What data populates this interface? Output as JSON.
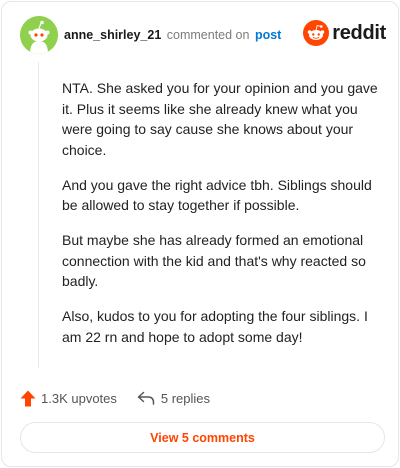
{
  "comment": {
    "username": "anne_shirley_21",
    "action_text": "commented on",
    "post_link": "post",
    "paragraphs": [
      "NTA. She asked you for your opinion and you gave it. Plus it seems like she already knew what you were going to say cause she knows about your choice.",
      "And you gave the right advice tbh. Siblings should be allowed to stay together if possible.",
      "But maybe she has already formed an emotional connection with the kid and that's why reacted so badly.",
      "Also, kudos to you for adopting the four siblings. I am 22 rn and hope to adopt some day!"
    ],
    "upvotes_label": "1.3K upvotes",
    "replies_label": "5 replies",
    "view_comments_label": "View 5 comments"
  },
  "brand": {
    "logo_text": "reddit",
    "accent_color": "#ff4500",
    "link_color": "#0079d3",
    "avatar_color": "#8fd14f"
  },
  "icons": {
    "avatar": "snoo-avatar-icon",
    "logo": "reddit-logo-icon",
    "upvote": "upvote-arrow-icon",
    "reply": "reply-arrow-icon"
  }
}
